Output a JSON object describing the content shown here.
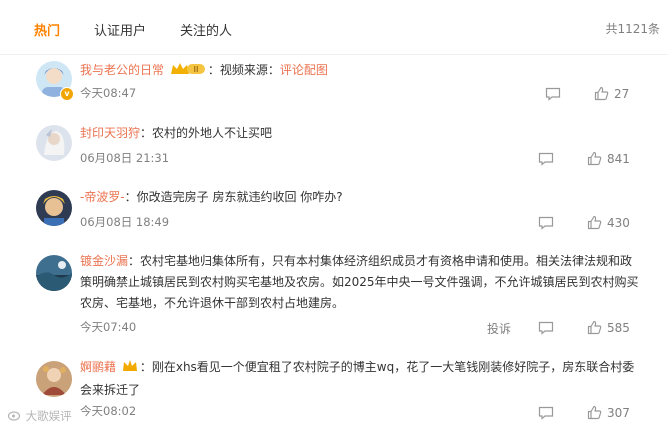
{
  "tabs": [
    "热门",
    "认证用户",
    "关注的人"
  ],
  "total": "共1121条",
  "comments": [
    {
      "user": "我与老公的日常",
      "level": "II",
      "parts": [
        "：视频来源：",
        "评论配图"
      ],
      "time": "今天08:47",
      "likes": "27"
    },
    {
      "user": "封印天羽狩",
      "text": "：农村的外地人不让买吧",
      "time": "06月08日 21:31",
      "likes": "841"
    },
    {
      "user": "-帝波罗-",
      "text": "：你改造完房子 房东就违约收回 你咋办?",
      "time": "06月08日 18:49",
      "likes": "430"
    },
    {
      "user": "镀金沙漏",
      "text_lines": [
        "：农村宅基地归集体所有，只有本村集体经济组织成员才有资格申请和使用。相关法律法规和政",
        "策明确禁止城镇居民到农村购买宅基地及农房。如2025年中央一号文件强调，不允许城镇居民到农村购买",
        "农房、宅基地，不允许退休干部到农村占地建房。"
      ],
      "time": "今天07:40",
      "report": "投诉",
      "likes": "585"
    },
    {
      "user": "婀鹂藉",
      "text_lines": [
        "：刚在xhs看见一个便宜租了农村院子的博主wq，花了一大笔钱刚装修好院子，房东联合村委",
        "会来拆迁了"
      ],
      "time": "今天08:02",
      "likes": "307"
    }
  ],
  "watermark": "大歌娱评",
  "colors": {
    "accent": "#ff8200",
    "username": "#eb7350"
  }
}
